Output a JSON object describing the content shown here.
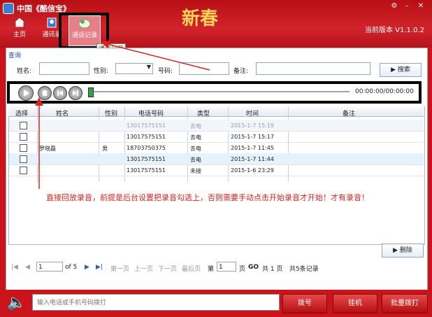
{
  "window": {
    "title": "中国《酷信宝》",
    "version": "当前版本 V1.1.0.2",
    "banner": "新春"
  },
  "nav": [
    {
      "label": "主页",
      "icon": "home-icon"
    },
    {
      "label": "通讯录",
      "icon": "contacts-icon"
    },
    {
      "label": "通话记录",
      "icon": "call-log-icon"
    }
  ],
  "tooltip": "通话记录",
  "query": {
    "section_label": "查询",
    "name_label": "姓名:",
    "gender_label": "性别:",
    "phone_label": "号码:",
    "note_label": "备注:",
    "search_label": "搜索"
  },
  "player": {
    "time": "00:00:00/00:00:00"
  },
  "table": {
    "headers": [
      "选择",
      "姓名",
      "性别",
      "电话号码",
      "类型",
      "时间",
      "备注"
    ],
    "rows": [
      {
        "name": "",
        "gender": "",
        "phone": "13017575151",
        "type": "去电",
        "time": "2015-1-7 15:19",
        "note": ""
      },
      {
        "name": "",
        "gender": "",
        "phone": "13017575151",
        "type": "去电",
        "time": "2015-1-7 15:17",
        "note": ""
      },
      {
        "name": "罗晓磊",
        "gender": "男",
        "phone": "18703750375",
        "type": "去电",
        "time": "2015-1-7 11:45",
        "note": ""
      },
      {
        "name": "",
        "gender": "",
        "phone": "13017575151",
        "type": "去电",
        "time": "2015-1-7 11:44",
        "note": ""
      },
      {
        "name": "",
        "gender": "",
        "phone": "13017575151",
        "type": "未接",
        "time": "2015-1-6 23:29",
        "note": ""
      }
    ]
  },
  "annotation": "直接回放录音，前提是后台设置把录音勾选上，否则需要手动点击开始录音才开始！才有录音！",
  "delete_label": "删除",
  "pager": {
    "page_value": "1",
    "of_label": "of 5",
    "first": "第一页",
    "prev": "上一页",
    "next": "下一页",
    "last": "最后页",
    "goto_prefix": "第",
    "goto_value": "1",
    "goto_suffix": "页",
    "go": "GO",
    "total_pages": "共 1 页",
    "total_records": "共5条记录"
  },
  "dialbar": {
    "placeholder": "输入电话或手机号码拨打",
    "dial_label": "拨号",
    "hangup_label": "挂机",
    "batch_label": "批量拨打"
  }
}
